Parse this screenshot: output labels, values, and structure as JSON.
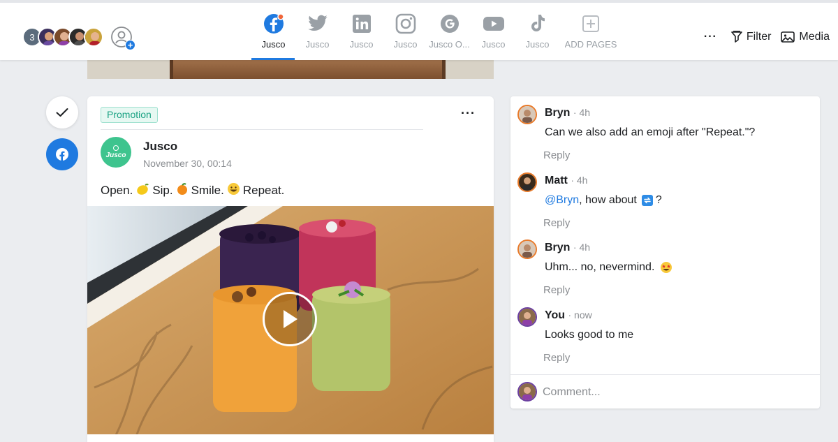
{
  "header": {
    "member_count": "3",
    "tabs": [
      {
        "label": "Jusco",
        "icon": "facebook-icon",
        "active": true
      },
      {
        "label": "Jusco",
        "icon": "twitter-icon",
        "active": false
      },
      {
        "label": "Jusco",
        "icon": "linkedin-icon",
        "active": false
      },
      {
        "label": "Jusco",
        "icon": "instagram-icon",
        "active": false
      },
      {
        "label": "Jusco O...",
        "icon": "google-icon",
        "active": false
      },
      {
        "label": "Jusco",
        "icon": "youtube-icon",
        "active": false
      },
      {
        "label": "Jusco",
        "icon": "tiktok-icon",
        "active": false
      },
      {
        "label": "ADD PAGES",
        "icon": "add-page-icon",
        "active": false
      }
    ],
    "more": "···",
    "filter_label": "Filter",
    "media_label": "Media"
  },
  "post": {
    "badge": "Promotion",
    "more": "···",
    "page_name": "Jusco",
    "logo_text": "Jusco",
    "date": "November 30, 00:14",
    "text_parts": [
      "Open.",
      "Sip.",
      "Smile.",
      "Repeat."
    ],
    "emojis": [
      "lemon",
      "tangerine",
      "grinning-face"
    ]
  },
  "comments": {
    "items": [
      {
        "name": "Bryn",
        "time": "· 4h",
        "body": "Can we also add an emoji after \"Repeat.\"?",
        "reply": "Reply"
      },
      {
        "name": "Matt",
        "time": "· 4h",
        "mention": "@Bryn",
        "body": ", how about",
        "body_end": "?",
        "reply": "Reply"
      },
      {
        "name": "Bryn",
        "time": "· 4h",
        "body": "Uhm... no, nevermind.",
        "reply": "Reply"
      },
      {
        "name": "You",
        "time": "· now",
        "body": "Looks good to me",
        "reply": "Reply"
      }
    ],
    "input_placeholder": "Comment..."
  },
  "colors": {
    "accent": "#1f7ae0",
    "promotion_green": "#1aa283",
    "brand_green": "#3ec48e"
  }
}
